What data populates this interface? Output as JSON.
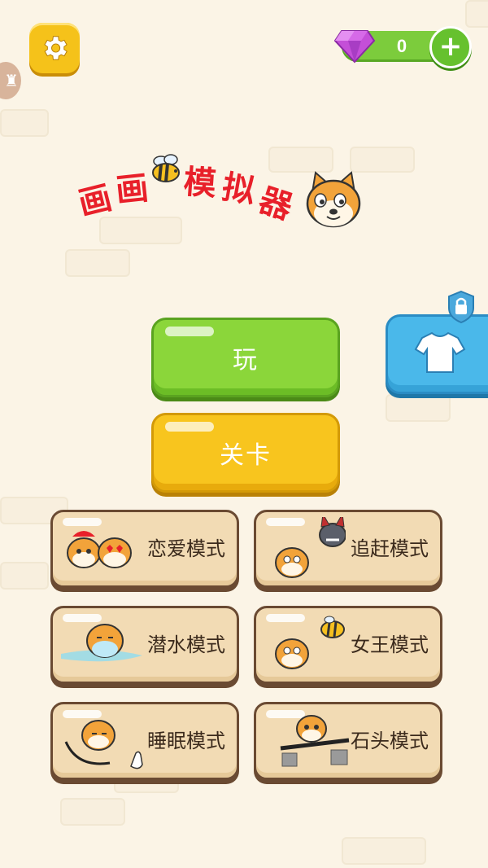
{
  "title": {
    "chars": [
      "画",
      "画",
      "模",
      "拟",
      "器"
    ]
  },
  "gems": {
    "count": "0"
  },
  "buttons": {
    "play_label": "玩",
    "levels_label": "关卡"
  },
  "modes": [
    {
      "label": "恋爱模式"
    },
    {
      "label": "追赶模式"
    },
    {
      "label": "潜水模式"
    },
    {
      "label": "女王模式"
    },
    {
      "label": "睡眠模式"
    },
    {
      "label": "石头模式"
    }
  ],
  "colors": {
    "play": "#8bd63a",
    "levels": "#f8c51e",
    "shop": "#4ab8ea",
    "title": "#e8202a",
    "gem": "#c44fd8"
  }
}
